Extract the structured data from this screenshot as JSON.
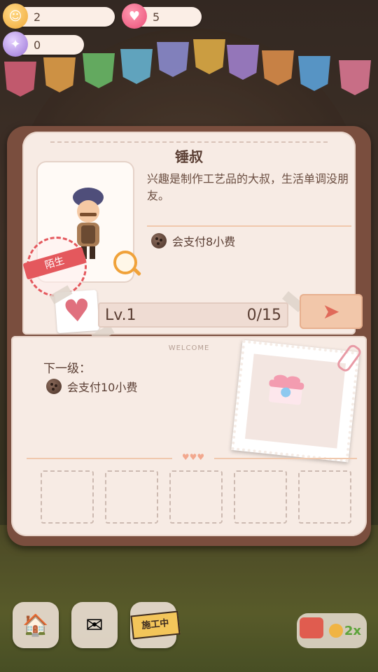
{
  "resources": {
    "coins": "2",
    "hearts": "5",
    "candy": "0"
  },
  "card": {
    "name": "锤叔",
    "description": "兴趣是制作工艺品的大叔，生活单调没朋友。",
    "pay_text": "会支付8小费",
    "relation_stamp": "陌生",
    "level": "Lv.1",
    "progress": "0/15",
    "progress_fraction": 0,
    "welcome": "WELCOME",
    "next_level_label": "下一级：",
    "next_pay_text": "会支付10小费",
    "hearts_divider": "♥♥♥"
  },
  "bottom": {
    "construction_label": "施工中",
    "speed_label": "2x"
  },
  "colors": {
    "accent": "#e4585d",
    "cover": "#7a4e3e",
    "page": "#f7ebe4",
    "send": "#f2c7aa"
  },
  "icons": [
    "coin-icon",
    "heart-icon",
    "candy-icon",
    "cookie-icon",
    "magnifier-icon",
    "heart-card-icon",
    "send-icon",
    "gift-icon",
    "paperclip-icon",
    "mushroom-house-icon",
    "letter-icon",
    "tv-icon"
  ]
}
